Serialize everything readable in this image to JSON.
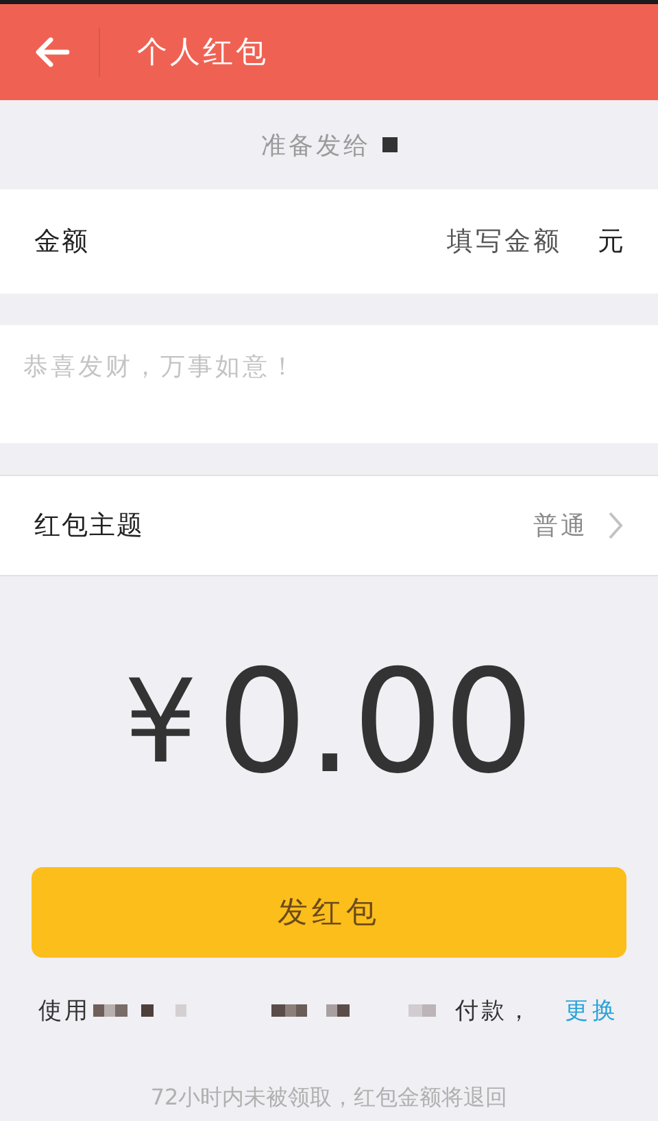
{
  "header": {
    "title": "个人红包"
  },
  "recipient": {
    "label": "准备发给"
  },
  "amount": {
    "label": "金额",
    "placeholder": "填写金额",
    "unit": "元"
  },
  "message": {
    "placeholder": "恭喜发财，万事如意！"
  },
  "theme": {
    "label": "红包主题",
    "value": "普通"
  },
  "total": {
    "currency": "¥",
    "value": "0.00"
  },
  "send_button": {
    "label": "发红包"
  },
  "payment": {
    "prefix": "使用",
    "suffix": "付款，",
    "change_link": "更换"
  },
  "footer_note": "72小时内未被领取，红包金额将退回"
}
